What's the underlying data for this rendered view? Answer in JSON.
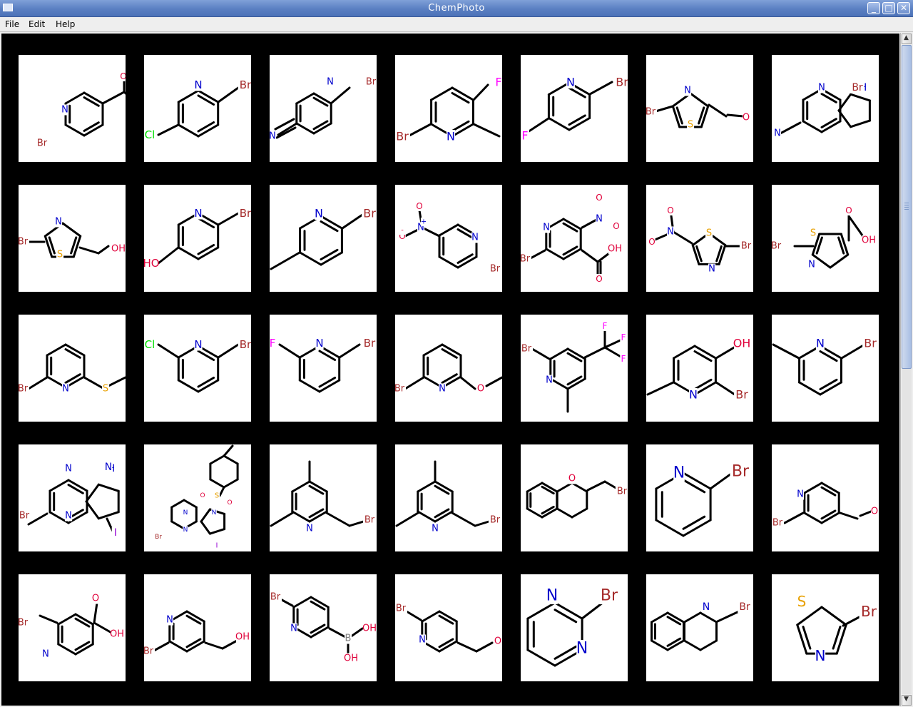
{
  "window": {
    "title": "ChemPhoto"
  },
  "window_controls": [
    {
      "name": "minimize-button",
      "glyph": "_"
    },
    {
      "name": "maximize-button",
      "glyph": "□"
    },
    {
      "name": "close-button",
      "glyph": "✕"
    }
  ],
  "menu": [
    {
      "label": "File",
      "name": "menu-file"
    },
    {
      "label": "Edit",
      "name": "menu-edit"
    },
    {
      "label": "Help",
      "name": "menu-help"
    }
  ],
  "grid": {
    "columns": 7,
    "rows": 5,
    "molecules": [
      {
        "row": 1,
        "col": 1,
        "name": "1-(6-bromopyridin-3-yl)ethanone",
        "labels": [
          {
            "text": "O",
            "color": "#e0003a"
          },
          {
            "text": "N",
            "color": "#0000cc"
          },
          {
            "text": "Br",
            "color": "#a52a2a"
          }
        ]
      },
      {
        "row": 1,
        "col": 2,
        "name": "2-bromo-5-chloropyridine",
        "labels": [
          {
            "text": "N",
            "color": "#0000cc"
          },
          {
            "text": "Br",
            "color": "#a52a2a"
          },
          {
            "text": "Cl",
            "color": "#00e000"
          }
        ]
      },
      {
        "row": 1,
        "col": 3,
        "name": "6-bromonicotinonitrile",
        "labels": [
          {
            "text": "N",
            "color": "#0000cc"
          },
          {
            "text": "Br",
            "color": "#a52a2a"
          },
          {
            "text": "N",
            "color": "#0000cc"
          }
        ]
      },
      {
        "row": 1,
        "col": 4,
        "name": "6-bromo-3-fluoro-2-methylpyridine",
        "labels": [
          {
            "text": "F",
            "color": "#ff00ff"
          },
          {
            "text": "Br",
            "color": "#a52a2a"
          },
          {
            "text": "N",
            "color": "#0000cc"
          }
        ]
      },
      {
        "row": 1,
        "col": 5,
        "name": "2-bromo-5-fluoropyridine",
        "labels": [
          {
            "text": "N",
            "color": "#0000cc"
          },
          {
            "text": "Br",
            "color": "#a52a2a"
          },
          {
            "text": "F",
            "color": "#ff00ff"
          }
        ]
      },
      {
        "row": 1,
        "col": 6,
        "name": "2-bromothiazole-5-carbaldehyde",
        "labels": [
          {
            "text": "N",
            "color": "#0000cc"
          },
          {
            "text": "Br",
            "color": "#a52a2a"
          },
          {
            "text": "S",
            "color": "#e8a000"
          },
          {
            "text": "O",
            "color": "#e0003a"
          }
        ]
      },
      {
        "row": 1,
        "col": 7,
        "name": "2-bromo-5H-pyrrolo[2,3-b]pyrazine",
        "labels": [
          {
            "text": "N",
            "color": "#0000cc"
          },
          {
            "text": "H",
            "color": "#0000cc"
          },
          {
            "text": "Br",
            "color": "#a52a2a"
          },
          {
            "text": "N",
            "color": "#0000cc"
          }
        ]
      },
      {
        "row": 2,
        "col": 1,
        "name": "(2-bromothiazol-5-yl)methanol",
        "labels": [
          {
            "text": "N",
            "color": "#0000cc"
          },
          {
            "text": "Br",
            "color": "#a52a2a"
          },
          {
            "text": "S",
            "color": "#e8a000"
          },
          {
            "text": "OH",
            "color": "#e0003a"
          }
        ]
      },
      {
        "row": 2,
        "col": 2,
        "name": "6-bromopyridin-3-ol",
        "labels": [
          {
            "text": "N",
            "color": "#0000cc"
          },
          {
            "text": "Br",
            "color": "#a52a2a"
          },
          {
            "text": "HO",
            "color": "#e0003a"
          }
        ]
      },
      {
        "row": 2,
        "col": 3,
        "name": "2-bromo-5-methylpyridine",
        "labels": [
          {
            "text": "N",
            "color": "#0000cc"
          },
          {
            "text": "Br",
            "color": "#a52a2a"
          }
        ]
      },
      {
        "row": 2,
        "col": 4,
        "name": "2-bromo-5-nitropyridine",
        "labels": [
          {
            "text": "O",
            "color": "#e0003a"
          },
          {
            "text": "N",
            "color": "#0000cc"
          },
          {
            "text": "+",
            "color": "#0000cc"
          },
          {
            "text": "O",
            "color": "#e0003a"
          },
          {
            "text": "-",
            "color": "#e0003a"
          },
          {
            "text": "N",
            "color": "#0000cc"
          },
          {
            "text": "Br",
            "color": "#a52a2a"
          }
        ]
      },
      {
        "row": 2,
        "col": 5,
        "name": "6-bromo-3-nitropyridine-4-carboxylic acid",
        "labels": [
          {
            "text": "O",
            "color": "#e0003a"
          },
          {
            "text": "N",
            "color": "#0000cc"
          },
          {
            "text": "O",
            "color": "#e0003a"
          },
          {
            "text": "N",
            "color": "#0000cc"
          },
          {
            "text": "Br",
            "color": "#a52a2a"
          },
          {
            "text": "OH",
            "color": "#e0003a"
          },
          {
            "text": "O",
            "color": "#e0003a"
          }
        ]
      },
      {
        "row": 2,
        "col": 6,
        "name": "2-bromo-5-nitrothiazole",
        "labels": [
          {
            "text": "O",
            "color": "#e0003a"
          },
          {
            "text": "N",
            "color": "#0000cc"
          },
          {
            "text": "O",
            "color": "#e0003a"
          },
          {
            "text": "S",
            "color": "#e8a000"
          },
          {
            "text": "Br",
            "color": "#a52a2a"
          },
          {
            "text": "N",
            "color": "#0000cc"
          }
        ]
      },
      {
        "row": 2,
        "col": 7,
        "name": "2-bromothiazole-5-carboxylic acid",
        "labels": [
          {
            "text": "O",
            "color": "#e0003a"
          },
          {
            "text": "S",
            "color": "#e8a000"
          },
          {
            "text": "Br",
            "color": "#a52a2a"
          },
          {
            "text": "OH",
            "color": "#e0003a"
          },
          {
            "text": "N",
            "color": "#0000cc"
          }
        ]
      },
      {
        "row": 3,
        "col": 1,
        "name": "2-bromo-6-(methylthio)pyridine",
        "labels": [
          {
            "text": "Br",
            "color": "#a52a2a"
          },
          {
            "text": "N",
            "color": "#0000cc"
          },
          {
            "text": "S",
            "color": "#e8a000"
          }
        ]
      },
      {
        "row": 3,
        "col": 2,
        "name": "2-bromo-6-chloropyridine",
        "labels": [
          {
            "text": "Cl",
            "color": "#00e000"
          },
          {
            "text": "N",
            "color": "#0000cc"
          },
          {
            "text": "Br",
            "color": "#a52a2a"
          }
        ]
      },
      {
        "row": 3,
        "col": 3,
        "name": "2-bromo-6-fluoropyridine",
        "labels": [
          {
            "text": "F",
            "color": "#ff00ff"
          },
          {
            "text": "N",
            "color": "#0000cc"
          },
          {
            "text": "Br",
            "color": "#a52a2a"
          }
        ]
      },
      {
        "row": 3,
        "col": 4,
        "name": "2-bromo-6-methoxypyridine",
        "labels": [
          {
            "text": "Br",
            "color": "#a52a2a"
          },
          {
            "text": "N",
            "color": "#0000cc"
          },
          {
            "text": "O",
            "color": "#e0003a"
          }
        ]
      },
      {
        "row": 3,
        "col": 5,
        "name": "2-bromo-6-methyl-4-(trifluoromethyl)pyridine",
        "labels": [
          {
            "text": "F",
            "color": "#ff00ff"
          },
          {
            "text": "F",
            "color": "#ff00ff"
          },
          {
            "text": "F",
            "color": "#ff00ff"
          },
          {
            "text": "Br",
            "color": "#a52a2a"
          },
          {
            "text": "N",
            "color": "#0000cc"
          }
        ]
      },
      {
        "row": 3,
        "col": 6,
        "name": "2-bromo-6-methylpyridin-3-ol",
        "labels": [
          {
            "text": "OH",
            "color": "#e0003a"
          },
          {
            "text": "N",
            "color": "#0000cc"
          },
          {
            "text": "Br",
            "color": "#a52a2a"
          }
        ]
      },
      {
        "row": 3,
        "col": 7,
        "name": "2-bromo-6-methylpyridine",
        "labels": [
          {
            "text": "N",
            "color": "#0000cc"
          },
          {
            "text": "Br",
            "color": "#a52a2a"
          }
        ]
      },
      {
        "row": 4,
        "col": 1,
        "name": "2-bromo-7-iodo-5H-pyrrolo[2,3-b]pyrazine",
        "labels": [
          {
            "text": "N",
            "color": "#0000cc"
          },
          {
            "text": "H",
            "color": "#0000cc"
          },
          {
            "text": "N",
            "color": "#0000cc"
          },
          {
            "text": "Br",
            "color": "#a52a2a"
          },
          {
            "text": "N",
            "color": "#0000cc"
          },
          {
            "text": "I",
            "color": "#9400d3"
          }
        ]
      },
      {
        "row": 4,
        "col": 2,
        "name": "2-bromo-7-iodo-5-tosyl-5H-pyrrolo[2,3-b]pyrazine",
        "labels": [
          {
            "text": "O",
            "color": "#e0003a"
          },
          {
            "text": "S",
            "color": "#e8a000"
          },
          {
            "text": "O",
            "color": "#e0003a"
          },
          {
            "text": "N",
            "color": "#0000cc"
          },
          {
            "text": "N",
            "color": "#0000cc"
          },
          {
            "text": "Br",
            "color": "#a52a2a"
          },
          {
            "text": "N",
            "color": "#0000cc"
          },
          {
            "text": "I",
            "color": "#9400d3"
          }
        ]
      },
      {
        "row": 4,
        "col": 3,
        "name": "2-(bromomethyl)-4,6-dimethylpyridine",
        "labels": [
          {
            "text": "N",
            "color": "#0000cc"
          },
          {
            "text": "Br",
            "color": "#a52a2a"
          }
        ]
      },
      {
        "row": 4,
        "col": 4,
        "name": "2-(bromomethyl)-4,6-dimethylpyridine",
        "labels": [
          {
            "text": "N",
            "color": "#0000cc"
          },
          {
            "text": "Br",
            "color": "#a52a2a"
          }
        ]
      },
      {
        "row": 4,
        "col": 5,
        "name": "2-(bromomethyl)chromane",
        "labels": [
          {
            "text": "O",
            "color": "#e0003a"
          },
          {
            "text": "Br",
            "color": "#a52a2a"
          }
        ]
      },
      {
        "row": 4,
        "col": 6,
        "name": "2-bromopyridine",
        "labels": [
          {
            "text": "N",
            "color": "#0000cc"
          },
          {
            "text": "Br",
            "color": "#a52a2a"
          }
        ]
      },
      {
        "row": 4,
        "col": 7,
        "name": "2-bromoisonicotinaldehyde",
        "labels": [
          {
            "text": "N",
            "color": "#0000cc"
          },
          {
            "text": "Br",
            "color": "#a52a2a"
          },
          {
            "text": "O",
            "color": "#e0003a"
          }
        ]
      },
      {
        "row": 5,
        "col": 1,
        "name": "2-bromoisonicotinic acid",
        "labels": [
          {
            "text": "O",
            "color": "#e0003a"
          },
          {
            "text": "Br",
            "color": "#a52a2a"
          },
          {
            "text": "OH",
            "color": "#e0003a"
          },
          {
            "text": "N",
            "color": "#0000cc"
          }
        ]
      },
      {
        "row": 5,
        "col": 2,
        "name": "(2-bromopyridin-4-yl)methanol",
        "labels": [
          {
            "text": "N",
            "color": "#0000cc"
          },
          {
            "text": "Br",
            "color": "#a52a2a"
          },
          {
            "text": "OH",
            "color": "#e0003a"
          }
        ]
      },
      {
        "row": 5,
        "col": 3,
        "name": "6-bromopyridin-3-ylboronic acid",
        "labels": [
          {
            "text": "Br",
            "color": "#a52a2a"
          },
          {
            "text": "N",
            "color": "#0000cc"
          },
          {
            "text": "OH",
            "color": "#e0003a"
          },
          {
            "text": "B",
            "color": "#808080"
          },
          {
            "text": "OH",
            "color": "#e0003a"
          }
        ]
      },
      {
        "row": 5,
        "col": 4,
        "name": "6-bromonicotinaldehyde",
        "labels": [
          {
            "text": "Br",
            "color": "#a52a2a"
          },
          {
            "text": "N",
            "color": "#0000cc"
          },
          {
            "text": "O",
            "color": "#e0003a"
          }
        ]
      },
      {
        "row": 5,
        "col": 5,
        "name": "2-bromopyrimidine",
        "labels": [
          {
            "text": "N",
            "color": "#0000cc"
          },
          {
            "text": "Br",
            "color": "#a52a2a"
          },
          {
            "text": "N",
            "color": "#0000cc"
          }
        ]
      },
      {
        "row": 5,
        "col": 6,
        "name": "2-bromoquinoline",
        "labels": [
          {
            "text": "N",
            "color": "#0000cc"
          },
          {
            "text": "Br",
            "color": "#a52a2a"
          }
        ]
      },
      {
        "row": 5,
        "col": 7,
        "name": "2-bromothiazole",
        "labels": [
          {
            "text": "S",
            "color": "#e8a000"
          },
          {
            "text": "Br",
            "color": "#a52a2a"
          },
          {
            "text": "N",
            "color": "#0000cc"
          }
        ]
      }
    ]
  },
  "scrollbar": {
    "position": 0.0,
    "visible_fraction": 0.5
  }
}
